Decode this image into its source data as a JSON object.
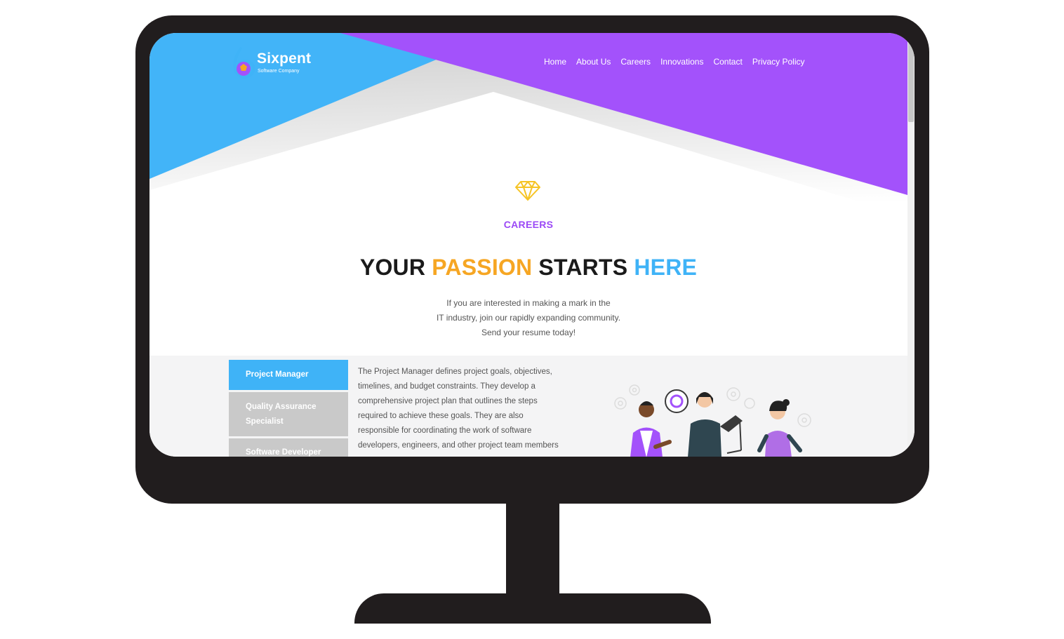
{
  "brand": {
    "name": "Sixpent",
    "tagline": "Software Company"
  },
  "nav": {
    "items": [
      {
        "label": "Home"
      },
      {
        "label": "About Us"
      },
      {
        "label": "Careers"
      },
      {
        "label": "Innovations"
      },
      {
        "label": "Contact"
      },
      {
        "label": "Privacy Policy"
      }
    ]
  },
  "hero": {
    "section_label": "CAREERS",
    "headline": {
      "part1": "YOUR ",
      "part2": "PASSION",
      "part3": " STARTS ",
      "part4": "HERE"
    },
    "intro_lines": [
      "If you are interested in making a mark in the",
      "IT industry, join our rapidly expanding community.",
      "Send your resume today!"
    ]
  },
  "jobs": {
    "tabs": [
      {
        "label": "Project Manager",
        "active": true
      },
      {
        "label": "Quality Assurance Specialist",
        "active": false
      },
      {
        "label": "Software Developer",
        "active": false
      }
    ],
    "description_lines": [
      "The Project Manager defines project goals, objectives,",
      "timelines, and budget constraints. They develop a",
      "comprehensive project plan that outlines the steps",
      "required to achieve these goals. They are also",
      "responsible for coordinating the work of software",
      "developers, engineers, and other project team members"
    ]
  },
  "colors": {
    "blue": "#3fb3f7",
    "purple": "#a352fb",
    "orange": "#f6a623",
    "label_purple": "#9b49f6",
    "monitor": "#211d1e",
    "tab_inactive": "#c9c9c9"
  },
  "icons": [
    "diamond-icon",
    "logo-mark-icon",
    "gear-icon"
  ]
}
